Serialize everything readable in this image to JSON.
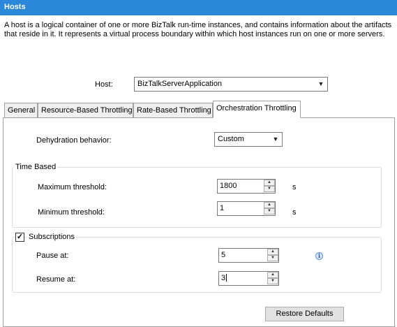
{
  "header": {
    "title": "Hosts"
  },
  "description": "A host is a logical container of one or more BizTalk run-time instances, and contains information about the artifacts that reside in it. It represents a virtual process boundary within which host instances run on one or more servers.",
  "host": {
    "label": "Host:",
    "value": "BizTalkServerApplication"
  },
  "tabs": [
    {
      "label": "General"
    },
    {
      "label": "Resource-Based Throttling"
    },
    {
      "label": "Rate-Based Throttling"
    },
    {
      "label": "Orchestration Throttling",
      "active": true
    }
  ],
  "dehydration": {
    "label": "Dehydration behavior:",
    "value": "Custom"
  },
  "time_based": {
    "title": "Time Based",
    "max": {
      "label": "Maximum threshold:",
      "value": "1800",
      "unit": "s"
    },
    "min": {
      "label": "Minimum threshold:",
      "value": "1",
      "unit": "s"
    }
  },
  "subscriptions": {
    "title": "Subscriptions",
    "checked": true,
    "pause": {
      "label": "Pause at:",
      "value": "5"
    },
    "resume": {
      "label": "Resume at:",
      "value": "3"
    }
  },
  "restore_button": "Restore Defaults",
  "icons": {
    "dropdown": "chevron-down-icon",
    "spin_up": "arrow-up-icon",
    "spin_down": "arrow-down-icon",
    "info": "info-icon",
    "check": "checkmark-icon"
  }
}
